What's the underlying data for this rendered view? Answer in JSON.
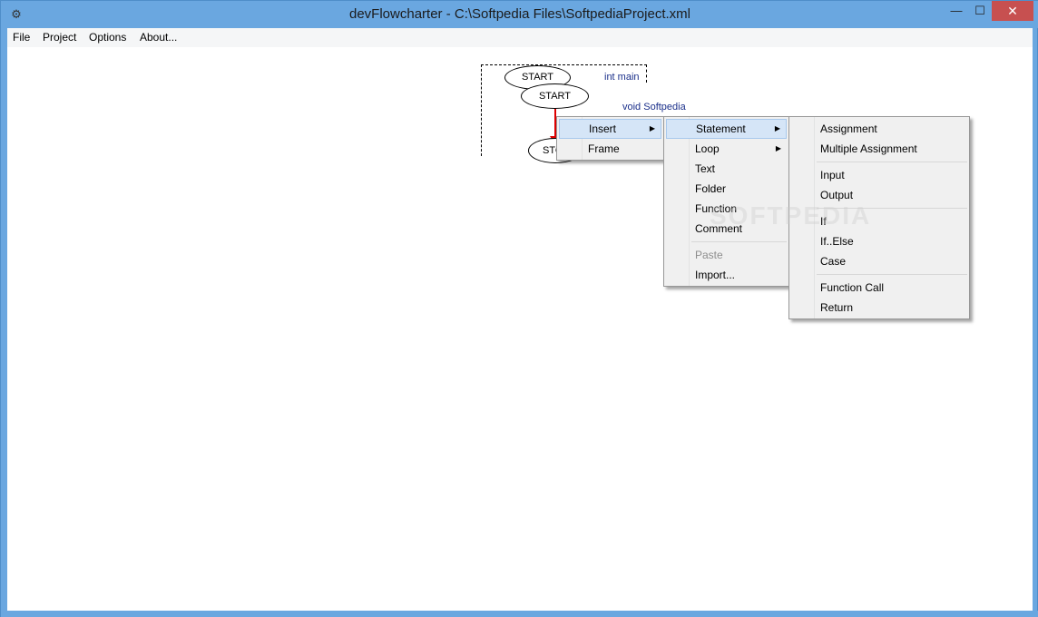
{
  "window": {
    "title": "devFlowcharter - C:\\Softpedia Files\\SoftpediaProject.xml",
    "minimize": "—",
    "maximize": "☐",
    "close": "✕"
  },
  "menubar": {
    "items": [
      "File",
      "Project",
      "Options",
      "About..."
    ]
  },
  "canvas": {
    "frame_label": "int main",
    "func_label": "void Softpedia",
    "oval_start_back": "START",
    "oval_start": "START",
    "oval_stop": "STOP",
    "oval_stop_visible": "STO"
  },
  "context_menu": {
    "items": [
      {
        "label": "Insert",
        "has_submenu": true,
        "selected": true
      },
      {
        "label": "Frame",
        "has_submenu": false,
        "selected": false
      }
    ]
  },
  "insert_menu": {
    "items": [
      {
        "label": "Statement",
        "has_submenu": true,
        "selected": true
      },
      {
        "label": "Loop",
        "has_submenu": true
      },
      {
        "label": "Text"
      },
      {
        "label": "Folder"
      },
      {
        "label": "Function"
      },
      {
        "label": "Comment"
      },
      {
        "label": "Paste",
        "disabled": true
      },
      {
        "label": "Import..."
      }
    ]
  },
  "statement_menu": {
    "items": [
      {
        "label": "Assignment"
      },
      {
        "label": "Multiple Assignment"
      },
      {
        "label": "Input"
      },
      {
        "label": "Output"
      },
      {
        "label": "If"
      },
      {
        "label": "If..Else"
      },
      {
        "label": "Case"
      },
      {
        "label": "Function Call"
      },
      {
        "label": "Return"
      }
    ]
  },
  "watermark": "SOFTPEDIA",
  "colors": {
    "titlebar": "#6aa7e0",
    "close_button": "#c75050",
    "menu_selected": "#d5e5f7",
    "flow_arrow": "#dd0000",
    "label_text": "#1a2f8a"
  }
}
